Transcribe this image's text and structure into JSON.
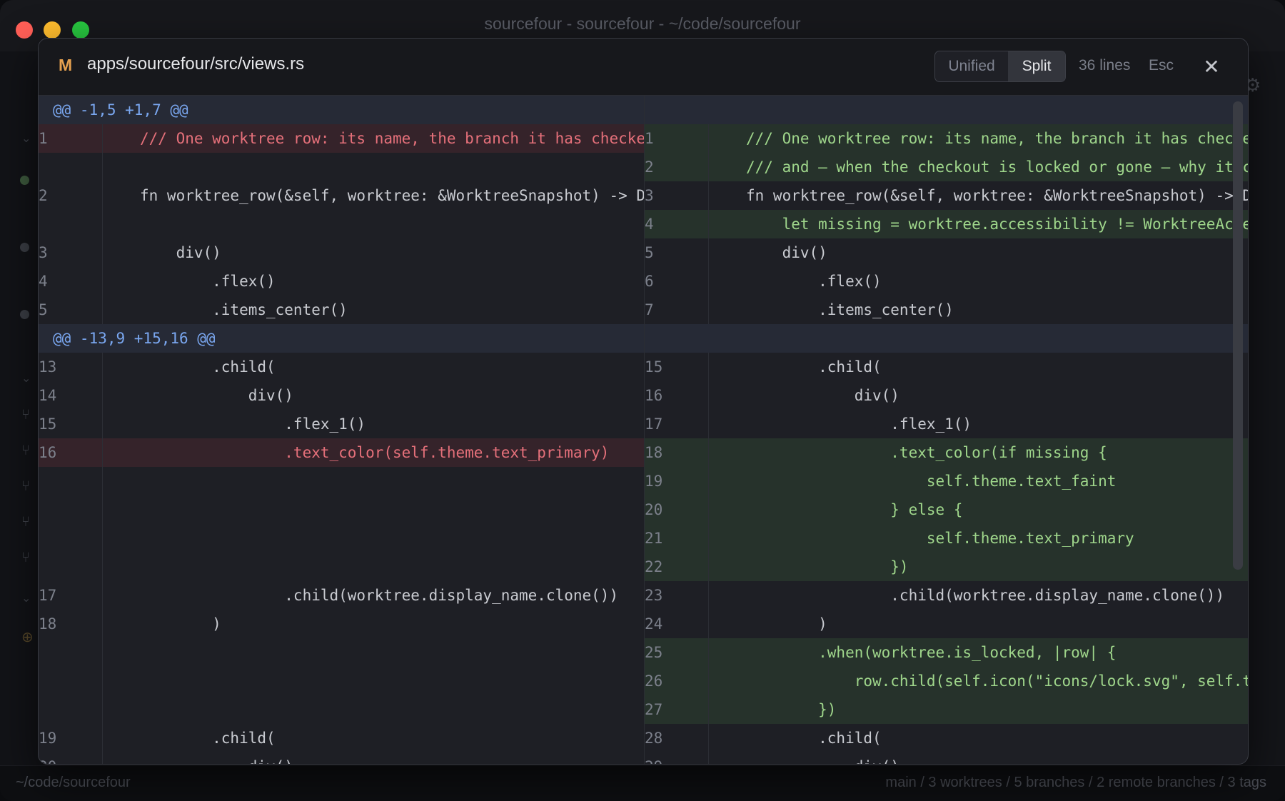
{
  "window": {
    "title": "sourcefour - sourcefour - ~/code/sourcefour"
  },
  "statusbar": {
    "path": "~/code/sourcefour",
    "summary": "main / 3 worktrees / 5 branches / 2 remote branches / 3 tags"
  },
  "modal": {
    "file_status": "M",
    "file_path": "apps/sourcefour/src/views.rs",
    "toggle": {
      "unified": "Unified",
      "split": "Split",
      "active": "split"
    },
    "line_count": "36 lines",
    "esc": "Esc",
    "close_glyph": "✕"
  },
  "colors": {
    "deleted_bg": "#35232a",
    "added_bg": "#26322b",
    "hunk_bg": "#262a36",
    "file_status_modified": "#e5a04f"
  },
  "diff": {
    "hunks": [
      {
        "header": "@@ -1,5 +1,7 @@",
        "rows": [
          {
            "left": {
              "n": "1",
              "text": "/// One worktree row: its name, the branch it has checked out,",
              "type": "del"
            },
            "right": {
              "n": "1",
              "text": "/// One worktree row: its name, the branch it has checked out,",
              "type": "add"
            }
          },
          {
            "left": null,
            "right": {
              "n": "2",
              "text": "/// and — when the checkout is locked or gone — why it can't be used.",
              "type": "add"
            }
          },
          {
            "left": {
              "n": "2",
              "text": "fn worktree_row(&self, worktree: &WorktreeSnapshot) -> Div {",
              "type": "ctx"
            },
            "right": {
              "n": "3",
              "text": "fn worktree_row(&self, worktree: &WorktreeSnapshot) -> Div {",
              "type": "ctx"
            }
          },
          {
            "left": null,
            "right": {
              "n": "4",
              "text": "    let missing = worktree.accessibility != WorktreeAccessibility::Available;",
              "type": "add"
            }
          },
          {
            "left": {
              "n": "3",
              "text": "    div()",
              "type": "ctx"
            },
            "right": {
              "n": "5",
              "text": "    div()",
              "type": "ctx"
            }
          },
          {
            "left": {
              "n": "4",
              "text": "        .flex()",
              "type": "ctx"
            },
            "right": {
              "n": "6",
              "text": "        .flex()",
              "type": "ctx"
            }
          },
          {
            "left": {
              "n": "5",
              "text": "        .items_center()",
              "type": "ctx"
            },
            "right": {
              "n": "7",
              "text": "        .items_center()",
              "type": "ctx"
            }
          }
        ]
      },
      {
        "header": "@@ -13,9 +15,16 @@",
        "rows": [
          {
            "left": {
              "n": "13",
              "text": "        .child(",
              "type": "ctx"
            },
            "right": {
              "n": "15",
              "text": "        .child(",
              "type": "ctx"
            }
          },
          {
            "left": {
              "n": "14",
              "text": "            div()",
              "type": "ctx"
            },
            "right": {
              "n": "16",
              "text": "            div()",
              "type": "ctx"
            }
          },
          {
            "left": {
              "n": "15",
              "text": "                .flex_1()",
              "type": "ctx"
            },
            "right": {
              "n": "17",
              "text": "                .flex_1()",
              "type": "ctx"
            }
          },
          {
            "left": {
              "n": "16",
              "text": "                .text_color(self.theme.text_primary)",
              "type": "del"
            },
            "right": {
              "n": "18",
              "text": "                .text_color(if missing {",
              "type": "add"
            }
          },
          {
            "left": null,
            "right": {
              "n": "19",
              "text": "                    self.theme.text_faint",
              "type": "add"
            }
          },
          {
            "left": null,
            "right": {
              "n": "20",
              "text": "                } else {",
              "type": "add"
            }
          },
          {
            "left": null,
            "right": {
              "n": "21",
              "text": "                    self.theme.text_primary",
              "type": "add"
            }
          },
          {
            "left": null,
            "right": {
              "n": "22",
              "text": "                })",
              "type": "add"
            }
          },
          {
            "left": {
              "n": "17",
              "text": "                .child(worktree.display_name.clone())",
              "type": "ctx"
            },
            "right": {
              "n": "23",
              "text": "                .child(worktree.display_name.clone())",
              "type": "ctx"
            }
          },
          {
            "left": {
              "n": "18",
              "text": "        )",
              "type": "ctx"
            },
            "right": {
              "n": "24",
              "text": "        )",
              "type": "ctx"
            }
          },
          {
            "left": null,
            "right": {
              "n": "25",
              "text": "        .when(worktree.is_locked, |row| {",
              "type": "add"
            }
          },
          {
            "left": null,
            "right": {
              "n": "26",
              "text": "            row.child(self.icon(\"icons/lock.svg\", self.theme.text_faint))",
              "type": "add"
            }
          },
          {
            "left": null,
            "right": {
              "n": "27",
              "text": "        })",
              "type": "add"
            }
          },
          {
            "left": {
              "n": "19",
              "text": "        .child(",
              "type": "ctx"
            },
            "right": {
              "n": "28",
              "text": "        .child(",
              "type": "ctx"
            }
          },
          {
            "left": {
              "n": "20",
              "text": "            div()",
              "type": "ctx"
            },
            "right": {
              "n": "29",
              "text": "            div()",
              "type": "ctx"
            }
          }
        ]
      }
    ]
  }
}
